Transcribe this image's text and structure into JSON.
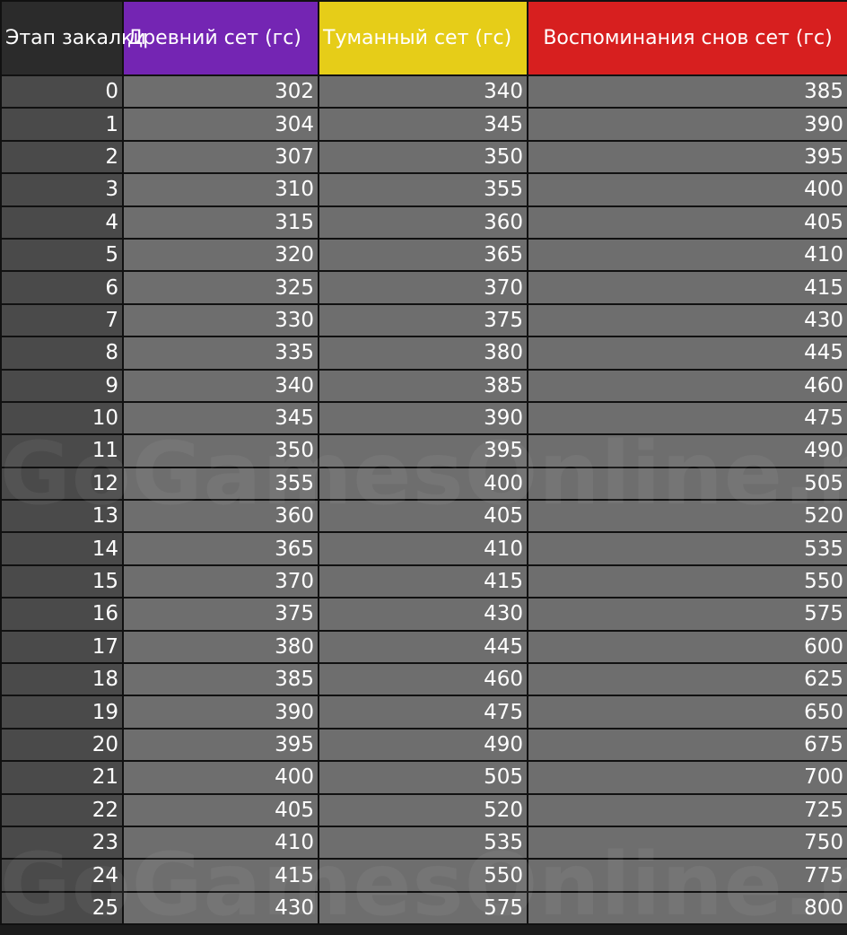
{
  "table": {
    "headers": {
      "stage": "Этап закалки",
      "ancient": "Древний сет (гс)",
      "misty": "Туманный сет (гс)",
      "dream": "Воспоминания снов сет (гс)"
    },
    "rows": [
      [
        "0",
        "302",
        "340",
        "385"
      ],
      [
        "1",
        "304",
        "345",
        "390"
      ],
      [
        "2",
        "307",
        "350",
        "395"
      ],
      [
        "3",
        "310",
        "355",
        "400"
      ],
      [
        "4",
        "315",
        "360",
        "405"
      ],
      [
        "5",
        "320",
        "365",
        "410"
      ],
      [
        "6",
        "325",
        "370",
        "415"
      ],
      [
        "7",
        "330",
        "375",
        "430"
      ],
      [
        "8",
        "335",
        "380",
        "445"
      ],
      [
        "9",
        "340",
        "385",
        "460"
      ],
      [
        "10",
        "345",
        "390",
        "475"
      ],
      [
        "11",
        "350",
        "395",
        "490"
      ],
      [
        "12",
        "355",
        "400",
        "505"
      ],
      [
        "13",
        "360",
        "405",
        "520"
      ],
      [
        "14",
        "365",
        "410",
        "535"
      ],
      [
        "15",
        "370",
        "415",
        "550"
      ],
      [
        "16",
        "375",
        "430",
        "575"
      ],
      [
        "17",
        "380",
        "445",
        "600"
      ],
      [
        "18",
        "385",
        "460",
        "625"
      ],
      [
        "19",
        "390",
        "475",
        "650"
      ],
      [
        "20",
        "395",
        "490",
        "675"
      ],
      [
        "21",
        "400",
        "505",
        "700"
      ],
      [
        "22",
        "405",
        "520",
        "725"
      ],
      [
        "23",
        "410",
        "535",
        "750"
      ],
      [
        "24",
        "415",
        "550",
        "775"
      ],
      [
        "25",
        "430",
        "575",
        "800"
      ]
    ]
  },
  "watermark": "GoGamesOnline.ru",
  "colors": {
    "ancient_header": "#7425b3",
    "misty_header": "#e6cd18",
    "dream_header": "#d71f1f",
    "stage_header": "#2b2b2b",
    "cell": "#6e6e6e",
    "stage_cell": "#4a4a4a"
  }
}
